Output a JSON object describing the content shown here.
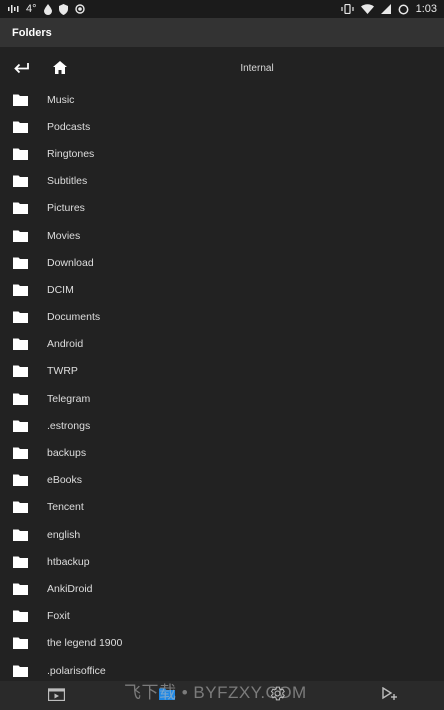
{
  "status_bar": {
    "temperature": "4°",
    "time": "1:03"
  },
  "app_bar": {
    "title": "Folders"
  },
  "nav": {
    "location": "Internal"
  },
  "folders": [
    "Music",
    "Podcasts",
    "Ringtones",
    "Subtitles",
    "Pictures",
    "Movies",
    "Download",
    "DCIM",
    "Documents",
    "Android",
    "TWRP",
    "Telegram",
    ".estrongs",
    "backups",
    "eBooks",
    "Tencent",
    "english",
    "htbackup",
    "AnkiDroid",
    "Foxit",
    "the legend 1900",
    ".polarisoffice"
  ],
  "bottom_nav": {
    "items": [
      "video-icon",
      "folder-icon",
      "settings-icon",
      "playlist-icon"
    ],
    "active_color": "#1e88e5"
  },
  "watermark": {
    "text": "飞下载 • BYFZXY.COM"
  },
  "colors": {
    "background": "#222222",
    "app_bar": "#333333",
    "status_bar": "#1b1b1b",
    "text": "#dedede"
  }
}
